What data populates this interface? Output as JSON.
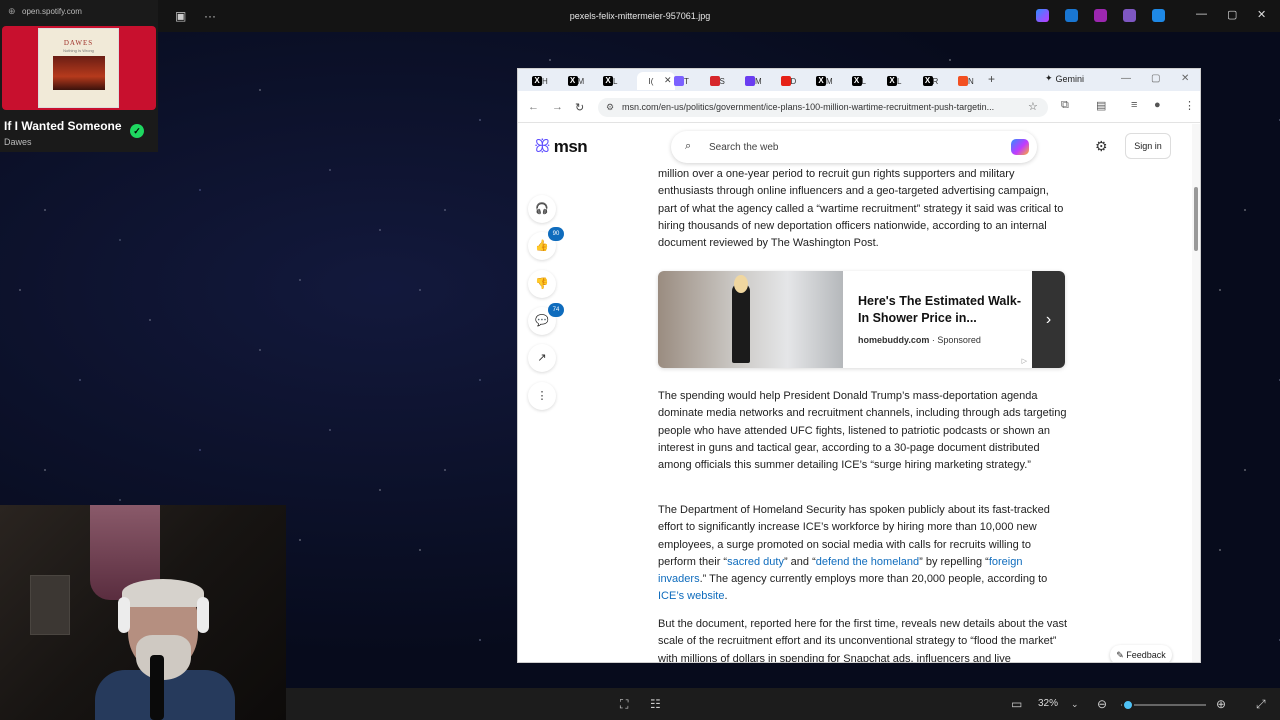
{
  "viewer": {
    "title": "pexels-felix-mittermeier-957061.jpg",
    "zoom": "32%"
  },
  "spotify": {
    "url": "open.spotify.com",
    "song": "If I Wanted Someone",
    "artist": "Dawes",
    "album_title": "DAWES",
    "album_subtitle": "Nothing Is Wrong"
  },
  "browser": {
    "tabs": [
      {
        "fav": "X",
        "label": "H",
        "color": "#000000"
      },
      {
        "fav": "X",
        "label": "M",
        "color": "#000000"
      },
      {
        "fav": "X",
        "label": "L",
        "color": "#000000"
      },
      {
        "fav": "",
        "label": "I(",
        "color": "#ffffff"
      },
      {
        "fav": "",
        "label": "T",
        "color": "#7b61ff"
      },
      {
        "fav": "",
        "label": "S",
        "color": "#d6262b"
      },
      {
        "fav": "",
        "label": "M",
        "color": "#6a3df1"
      },
      {
        "fav": "",
        "label": "D",
        "color": "#e62117"
      },
      {
        "fav": "X",
        "label": "M",
        "color": "#000000"
      },
      {
        "fav": "X",
        "label": "L",
        "color": "#000000"
      },
      {
        "fav": "X",
        "label": "L",
        "color": "#000000"
      },
      {
        "fav": "X",
        "label": "R",
        "color": "#000000"
      },
      {
        "fav": "",
        "label": "N",
        "color": "#f25022"
      }
    ],
    "gemini_label": "Gemini",
    "url": "msn.com/en-us/politics/government/ice-plans-100-million-wartime-recruitment-push-targetin..."
  },
  "msn": {
    "logo": "msn",
    "search_placeholder": "Search the web",
    "signin": "Sign in",
    "likes_count": "90",
    "comments_count": "74",
    "feedback": "Feedback"
  },
  "article": {
    "p1": "million over a one-year period to recruit gun rights supporters and military enthusiasts through online influencers and a geo-targeted advertising campaign, part of what the agency called a “wartime recruitment” strategy it said was critical to hiring thousands of new deportation officers nationwide, according to an internal document reviewed by The Washington Post.",
    "p2": "The spending would help President Donald Trump’s mass-deportation agenda dominate media networks and recruitment channels, including through ads targeting people who have attended UFC fights, listened to patriotic podcasts or shown an interest in guns and tactical gear, according to a 30-page document distributed among officials this summer detailing ICE’s “surge hiring marketing strategy.”",
    "p3_a": "The Department of Homeland Security has spoken publicly about its fast-tracked effort to significantly increase ICE’s workforce by hiring more than 10,000 new employees, a surge promoted on social media with calls for recruits willing to perform their “",
    "p3_link1": "sacred duty",
    "p3_b": "” and “",
    "p3_link2": "defend the homeland",
    "p3_c": "” by repelling “",
    "p3_link3": "foreign invaders",
    "p3_d": ".” The agency currently employs more than 20,000 people, according to ",
    "p3_link4": "ICE’s website",
    "p3_e": ".",
    "p4": "But the document, reported here for the first time, reveals new details about the vast scale of the recruitment effort and its unconventional strategy to “flood the market” with millions of dollars in spending for Snapchat ads, influencers and live"
  },
  "ad": {
    "title": "Here's The Estimated Walk-In Shower Price in...",
    "source": "homebuddy.com",
    "sponsored": "Sponsored"
  }
}
